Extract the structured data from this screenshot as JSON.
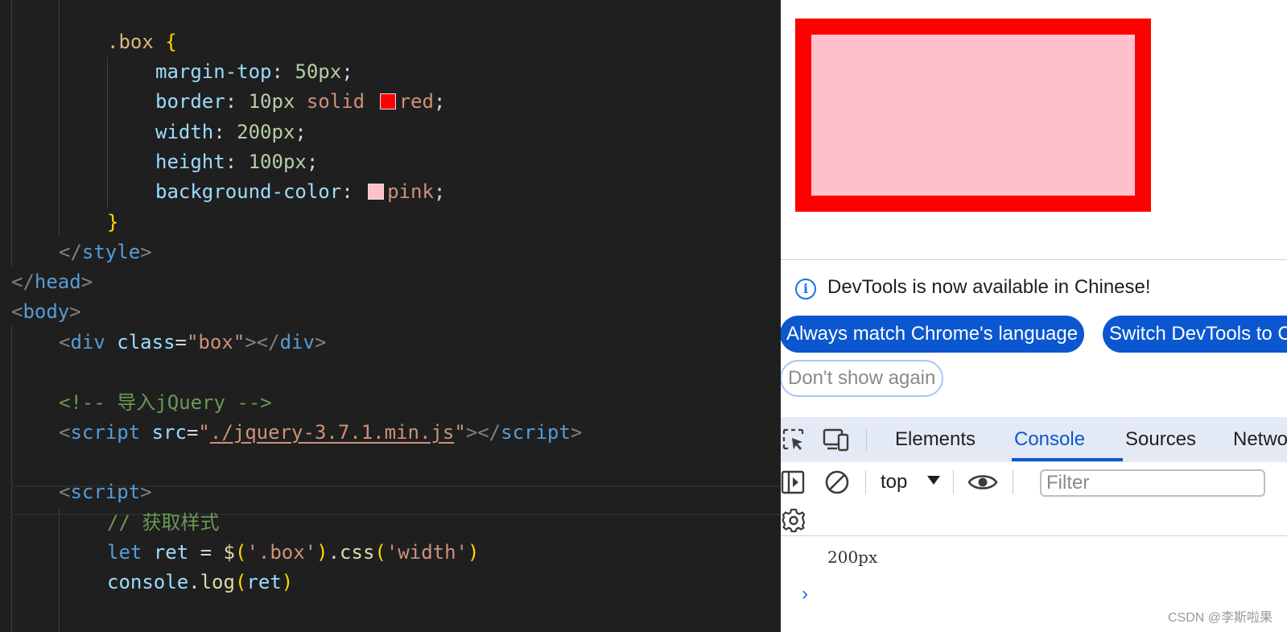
{
  "editor": {
    "lines": [
      {
        "indent": "        ",
        "tokens": [
          [
            ".box",
            "sel"
          ],
          [
            " ",
            "plain"
          ],
          [
            "{",
            "brace"
          ]
        ]
      },
      {
        "indent": "            ",
        "tokens": [
          [
            "margin-top",
            "prop"
          ],
          [
            ": ",
            "plain"
          ],
          [
            "50px",
            "num"
          ],
          [
            ";",
            "plain"
          ]
        ]
      },
      {
        "indent": "            ",
        "tokens": [
          [
            "border",
            "prop"
          ],
          [
            ": ",
            "plain"
          ],
          [
            "10px",
            "num"
          ],
          [
            " solid ",
            "val"
          ],
          [
            "#ff0000",
            "swatch"
          ],
          [
            "red",
            "val"
          ],
          [
            ";",
            "plain"
          ]
        ]
      },
      {
        "indent": "            ",
        "tokens": [
          [
            "width",
            "prop"
          ],
          [
            ": ",
            "plain"
          ],
          [
            "200px",
            "num"
          ],
          [
            ";",
            "plain"
          ]
        ]
      },
      {
        "indent": "            ",
        "tokens": [
          [
            "height",
            "prop"
          ],
          [
            ": ",
            "plain"
          ],
          [
            "100px",
            "num"
          ],
          [
            ";",
            "plain"
          ]
        ]
      },
      {
        "indent": "            ",
        "tokens": [
          [
            "background-color",
            "prop"
          ],
          [
            ": ",
            "plain"
          ],
          [
            "#ffc0cb",
            "swatch"
          ],
          [
            "pink",
            "val"
          ],
          [
            ";",
            "plain"
          ]
        ]
      },
      {
        "indent": "        ",
        "tokens": [
          [
            "}",
            "brace"
          ]
        ]
      },
      {
        "indent": "    ",
        "tokens": [
          [
            "</",
            "tagp"
          ],
          [
            "style",
            "tag"
          ],
          [
            ">",
            "tagp"
          ]
        ]
      },
      {
        "indent": "",
        "tokens": [
          [
            "</",
            "tagp"
          ],
          [
            "head",
            "tag"
          ],
          [
            ">",
            "tagp"
          ]
        ]
      },
      {
        "indent": "",
        "tokens": [
          [
            "<",
            "tagp"
          ],
          [
            "body",
            "tag"
          ],
          [
            ">",
            "tagp"
          ]
        ]
      },
      {
        "indent": "    ",
        "tokens": [
          [
            "<",
            "tagp"
          ],
          [
            "div",
            "tag"
          ],
          [
            " ",
            "plain"
          ],
          [
            "class",
            "attr"
          ],
          [
            "=",
            "plain"
          ],
          [
            "\"box\"",
            "str"
          ],
          [
            "></",
            "tagp"
          ],
          [
            "div",
            "tag"
          ],
          [
            ">",
            "tagp"
          ]
        ]
      },
      {
        "indent": "",
        "tokens": []
      },
      {
        "indent": "    ",
        "tokens": [
          [
            "<!-- 导入jQuery -->",
            "cmt"
          ]
        ]
      },
      {
        "indent": "    ",
        "tokens": [
          [
            "<",
            "tagp"
          ],
          [
            "script",
            "tag"
          ],
          [
            " ",
            "plain"
          ],
          [
            "src",
            "attr"
          ],
          [
            "=",
            "plain"
          ],
          [
            "\"",
            "str"
          ],
          [
            "./jquery-3.7.1.min.js",
            "str link"
          ],
          [
            "\"",
            "str"
          ],
          [
            "></",
            "tagp"
          ],
          [
            "script",
            "tag"
          ],
          [
            ">",
            "tagp"
          ]
        ]
      },
      {
        "indent": "",
        "tokens": []
      },
      {
        "indent": "    ",
        "tokens": [
          [
            "<",
            "tagp"
          ],
          [
            "script",
            "tag"
          ],
          [
            ">",
            "tagp"
          ]
        ]
      },
      {
        "indent": "        ",
        "tokens": [
          [
            "// 获取样式",
            "cmt"
          ]
        ]
      },
      {
        "indent": "        ",
        "tokens": [
          [
            "let",
            "kw"
          ],
          [
            " ",
            "plain"
          ],
          [
            "ret",
            "var"
          ],
          [
            " = ",
            "plain"
          ],
          [
            "$",
            "fn"
          ],
          [
            "(",
            "brace"
          ],
          [
            "'.box'",
            "str"
          ],
          [
            ")",
            "brace"
          ],
          [
            ".",
            "plain"
          ],
          [
            "css",
            "fn"
          ],
          [
            "(",
            "brace"
          ],
          [
            "'width'",
            "str"
          ],
          [
            ")",
            "brace"
          ]
        ]
      },
      {
        "indent": "        ",
        "tokens": [
          [
            "console",
            "var"
          ],
          [
            ".",
            "plain"
          ],
          [
            "log",
            "fn"
          ],
          [
            "(",
            "brace"
          ],
          [
            "ret",
            "var"
          ],
          [
            ")",
            "brace"
          ]
        ]
      }
    ]
  },
  "devtools": {
    "info_text": "DevTools is now available in Chinese!",
    "btn_match": "Always match Chrome's language",
    "btn_switch": "Switch DevTools to Chinese",
    "btn_dont_show": "Don't show again",
    "tabs": [
      "Elements",
      "Console",
      "Sources",
      "Network"
    ],
    "active_tab": "Console",
    "context": "top",
    "filter_placeholder": "Filter",
    "log_output": "200px",
    "prompt": "›"
  },
  "watermark": "CSDN @李斯啦果"
}
